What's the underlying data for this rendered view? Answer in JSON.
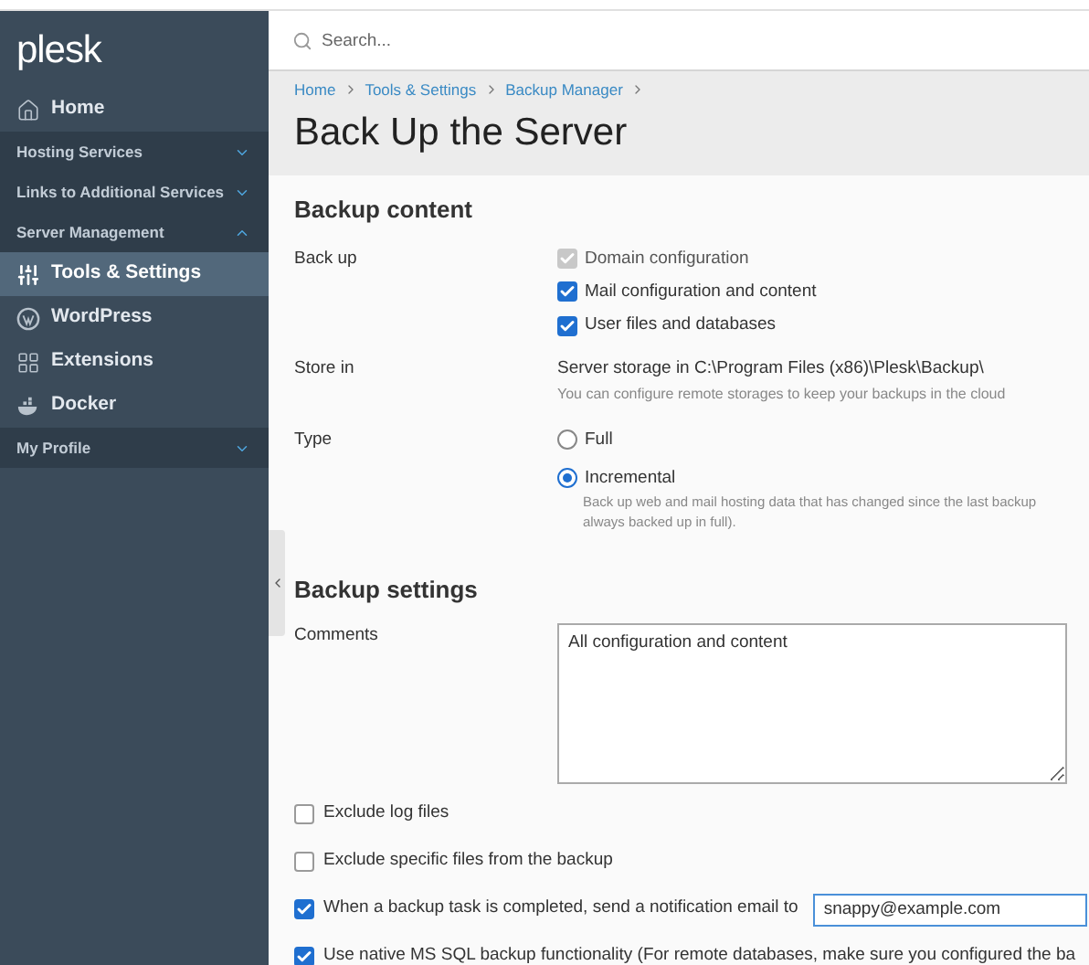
{
  "sidebar": {
    "logo": "plesk",
    "items": [
      {
        "kind": "item",
        "label": "Home",
        "selected": false
      },
      {
        "kind": "group",
        "label": "Hosting Services",
        "expanded": false
      },
      {
        "kind": "group",
        "label": "Links to Additional Services",
        "expanded": false
      },
      {
        "kind": "group",
        "label": "Server Management",
        "expanded": true
      },
      {
        "kind": "item",
        "label": "Tools & Settings",
        "selected": true
      },
      {
        "kind": "item",
        "label": "WordPress",
        "selected": false
      },
      {
        "kind": "item",
        "label": "Extensions",
        "selected": false
      },
      {
        "kind": "item",
        "label": "Docker",
        "selected": false
      },
      {
        "kind": "group",
        "label": "My Profile",
        "expanded": false
      }
    ]
  },
  "search": {
    "placeholder": "Search..."
  },
  "breadcrumbs": [
    "Home",
    "Tools & Settings",
    "Backup Manager"
  ],
  "title": "Back Up the Server",
  "backup_content": {
    "heading": "Backup content",
    "back_up": {
      "label": "Back up",
      "options": [
        {
          "label": "Domain configuration",
          "checked": true,
          "disabled": true
        },
        {
          "label": "Mail configuration and content",
          "checked": true,
          "disabled": false
        },
        {
          "label": "User files and databases",
          "checked": true,
          "disabled": false
        }
      ]
    },
    "store_in": {
      "label": "Store in",
      "value": "Server storage in C:\\Program Files (x86)\\Plesk\\Backup\\",
      "hint": "You can configure remote storages to keep your backups in the cloud"
    },
    "type": {
      "label": "Type",
      "options": [
        {
          "label": "Full",
          "selected": false
        },
        {
          "label": "Incremental",
          "selected": true,
          "hint": [
            "Back up web and mail hosting data that has changed since the last backup",
            "always backed up in full)."
          ]
        }
      ]
    }
  },
  "backup_settings": {
    "heading": "Backup settings",
    "comments": {
      "label": "Comments",
      "value": "All configuration and content"
    },
    "options": [
      {
        "label": "Exclude log files",
        "checked": false
      },
      {
        "label": "Exclude specific files from the backup",
        "checked": false
      },
      {
        "label": "When a backup task is completed, send a notification email to",
        "checked": true,
        "email": "snappy@example.com"
      },
      {
        "label": "Use native MS SQL backup functionality (For remote databases, make sure you configured the ba",
        "checked": true
      }
    ]
  }
}
